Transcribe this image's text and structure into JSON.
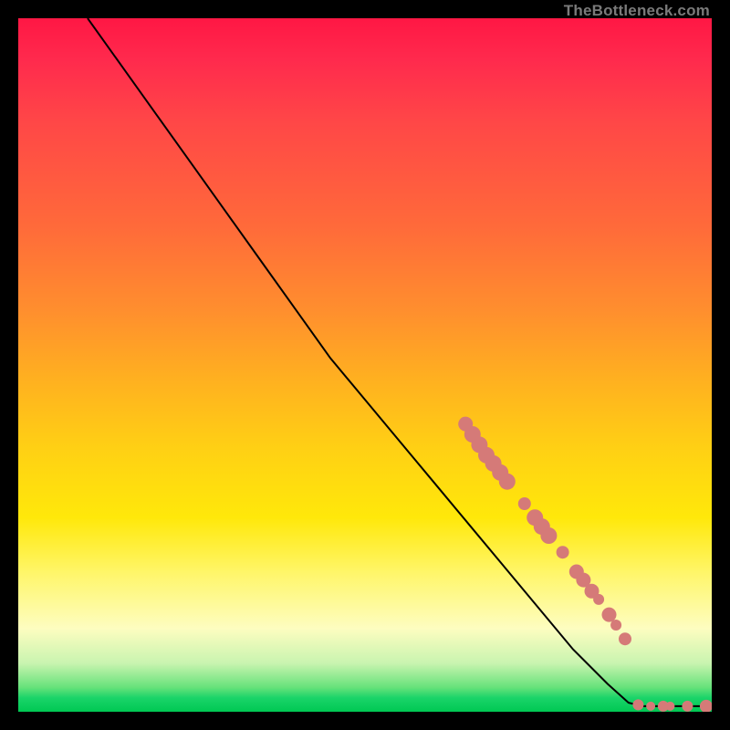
{
  "watermark": "TheBottleneck.com",
  "colors": {
    "background_black": "#000000",
    "curve_stroke": "#000000",
    "point_fill": "#d57a78",
    "gradient_top": "#ff1744",
    "gradient_mid": "#ffe80a",
    "gradient_bottom": "#00c853"
  },
  "chart_data": {
    "type": "line",
    "title": "",
    "xlabel": "",
    "ylabel": "",
    "xlim": [
      0,
      100
    ],
    "ylim": [
      0,
      100
    ],
    "grid": false,
    "curve": [
      {
        "x": 10,
        "y": 100
      },
      {
        "x": 15,
        "y": 93
      },
      {
        "x": 20,
        "y": 86
      },
      {
        "x": 25,
        "y": 79
      },
      {
        "x": 30,
        "y": 72
      },
      {
        "x": 35,
        "y": 65
      },
      {
        "x": 40,
        "y": 58
      },
      {
        "x": 45,
        "y": 51
      },
      {
        "x": 50,
        "y": 45
      },
      {
        "x": 55,
        "y": 39
      },
      {
        "x": 60,
        "y": 33
      },
      {
        "x": 65,
        "y": 27
      },
      {
        "x": 70,
        "y": 21
      },
      {
        "x": 75,
        "y": 15
      },
      {
        "x": 80,
        "y": 9
      },
      {
        "x": 85,
        "y": 4
      },
      {
        "x": 88,
        "y": 1.3
      },
      {
        "x": 90,
        "y": 0.8
      },
      {
        "x": 92,
        "y": 0.8
      },
      {
        "x": 95,
        "y": 0.8
      },
      {
        "x": 98,
        "y": 0.8
      },
      {
        "x": 100,
        "y": 0.8
      }
    ],
    "series": [
      {
        "name": "markers",
        "points": [
          {
            "x": 64.5,
            "y": 41.5,
            "size": 8
          },
          {
            "x": 65.5,
            "y": 40.0,
            "size": 9
          },
          {
            "x": 66.5,
            "y": 38.5,
            "size": 9
          },
          {
            "x": 67.5,
            "y": 37.0,
            "size": 9
          },
          {
            "x": 68.5,
            "y": 35.8,
            "size": 9
          },
          {
            "x": 69.5,
            "y": 34.5,
            "size": 9
          },
          {
            "x": 70.5,
            "y": 33.2,
            "size": 9
          },
          {
            "x": 73.0,
            "y": 30.0,
            "size": 7
          },
          {
            "x": 74.5,
            "y": 28.0,
            "size": 9
          },
          {
            "x": 75.5,
            "y": 26.7,
            "size": 9
          },
          {
            "x": 76.5,
            "y": 25.4,
            "size": 9
          },
          {
            "x": 78.5,
            "y": 23.0,
            "size": 7
          },
          {
            "x": 80.5,
            "y": 20.2,
            "size": 8
          },
          {
            "x": 81.5,
            "y": 19.0,
            "size": 8
          },
          {
            "x": 82.7,
            "y": 17.4,
            "size": 8
          },
          {
            "x": 83.7,
            "y": 16.2,
            "size": 6
          },
          {
            "x": 85.2,
            "y": 14.0,
            "size": 8
          },
          {
            "x": 86.2,
            "y": 12.5,
            "size": 6
          },
          {
            "x": 87.5,
            "y": 10.5,
            "size": 7
          },
          {
            "x": 89.4,
            "y": 1.0,
            "size": 6
          },
          {
            "x": 91.2,
            "y": 0.8,
            "size": 5
          },
          {
            "x": 93.0,
            "y": 0.8,
            "size": 6
          },
          {
            "x": 94.0,
            "y": 0.8,
            "size": 5
          },
          {
            "x": 96.5,
            "y": 0.8,
            "size": 6
          },
          {
            "x": 99.2,
            "y": 0.8,
            "size": 7
          }
        ]
      }
    ]
  }
}
